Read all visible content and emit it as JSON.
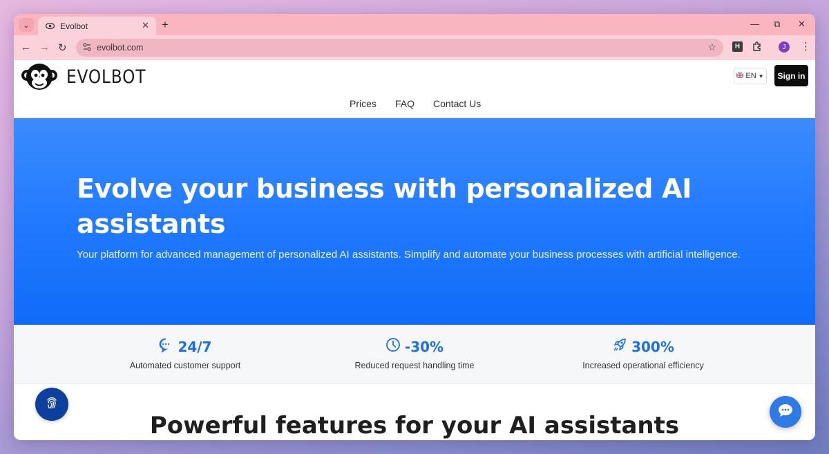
{
  "browser": {
    "tab_title": "Evolbot",
    "url": "evolbot.com",
    "profile_initial": "J",
    "ext_letter": "H"
  },
  "site": {
    "logo_text": "EVOLBOT",
    "lang": "EN",
    "signin_label": "Sign in",
    "nav": [
      "Prices",
      "FAQ",
      "Contact Us"
    ]
  },
  "hero": {
    "title": "Evolve your business with personalized AI assistants",
    "subtitle": "Your platform for advanced management of personalized AI assistants. Simplify and automate your business processes with artificial intelligence."
  },
  "stats": [
    {
      "icon": "chat-dots-icon",
      "value": "24/7",
      "label": "Automated customer support"
    },
    {
      "icon": "clock-icon",
      "value": "-30%",
      "label": "Reduced request handling time"
    },
    {
      "icon": "rocket-icon",
      "value": "300%",
      "label": "Increased operational efficiency"
    }
  ],
  "features": {
    "title": "Powerful features for your AI assistants"
  },
  "colors": {
    "hero_blue": "#1f78ff",
    "accent": "#1c6fe8",
    "tab_strip": "#f9b6c1"
  }
}
